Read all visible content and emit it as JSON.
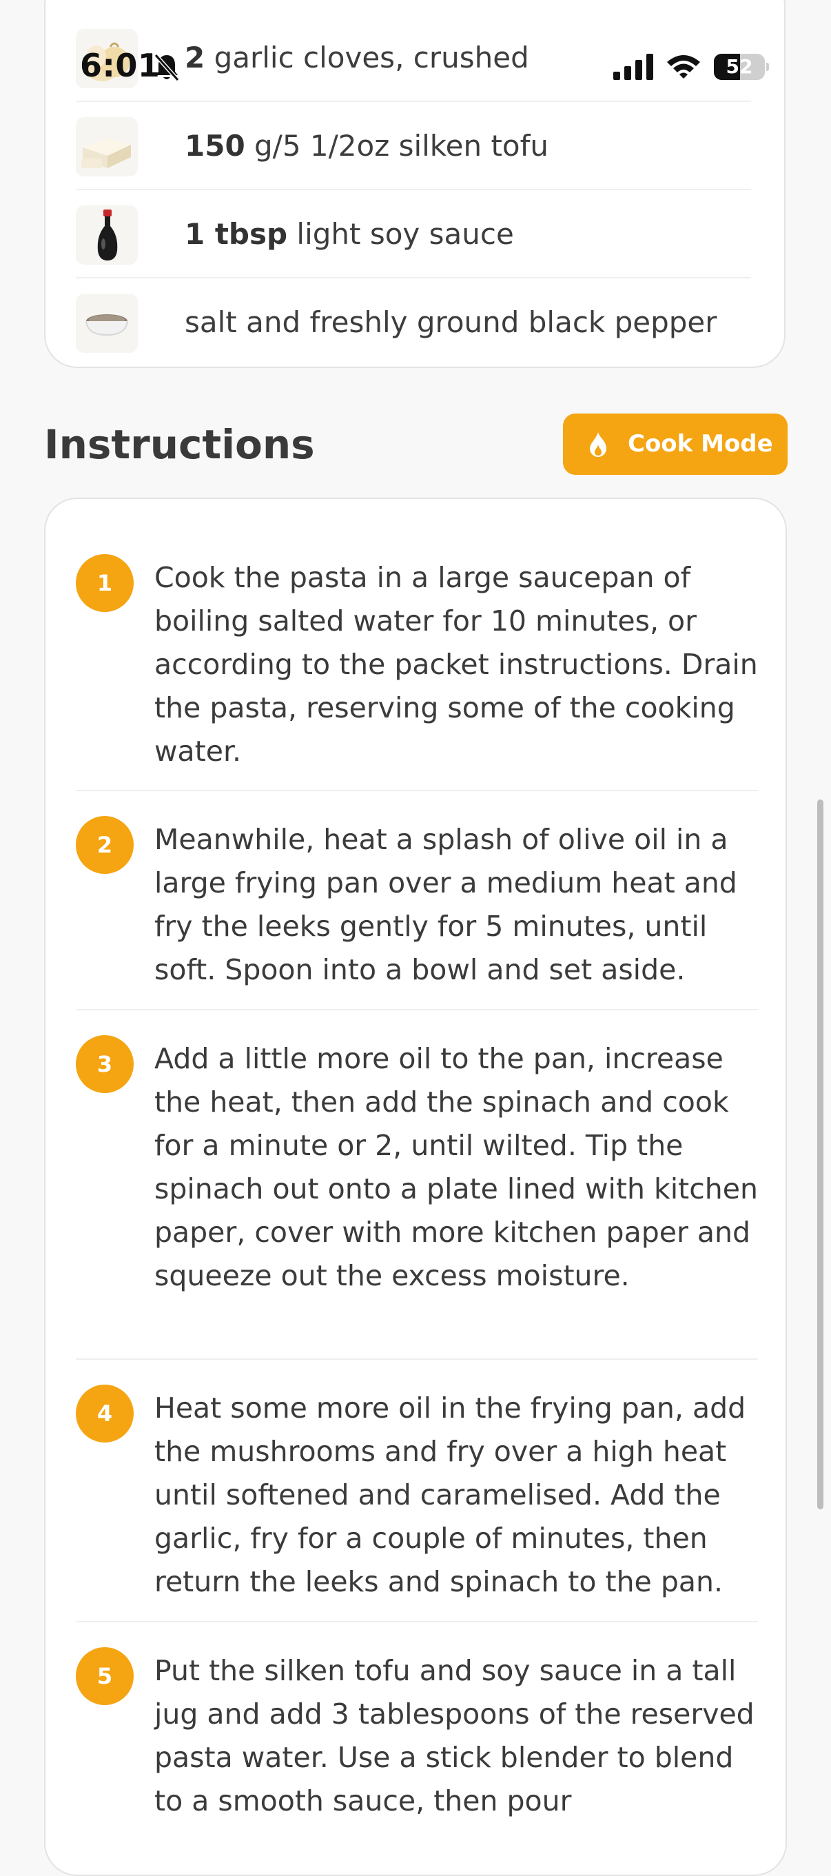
{
  "status_bar": {
    "time": "6:01",
    "battery_level": "52",
    "battery_fraction": 0.52,
    "icons": [
      "bell-slash-icon",
      "signal-icon",
      "wifi-icon",
      "battery-icon"
    ]
  },
  "ingredients": [
    {
      "amount": "2",
      "text": " garlic cloves, crushed",
      "icon": "garlic-icon"
    },
    {
      "amount": "150",
      "text": " g/5 1/2oz silken tofu",
      "icon": "tofu-icon"
    },
    {
      "amount": "1 tbsp",
      "text": " light soy sauce",
      "icon": "soy-sauce-icon"
    },
    {
      "amount": "",
      "text": "salt and freshly ground black pepper",
      "icon": "pepper-bowl-icon"
    }
  ],
  "instructions": {
    "title": "Instructions",
    "cook_mode_label": "Cook Mode",
    "steps": [
      {
        "number": "1",
        "text": "Cook the pasta in a large saucepan of boiling salted water for 10 minutes, or according to the packet instructions. Drain the pasta, reserving some of the cooking water."
      },
      {
        "number": "2",
        "text": "Meanwhile, heat a splash of olive oil in a large frying pan over a medium heat and fry the leeks gently for 5 minutes, until soft. Spoon into a bowl and set aside."
      },
      {
        "number": "3",
        "text": "Add a little more oil to the pan, increase the heat, then add the spinach and cook for a minute or 2, until wilted. Tip the spinach out onto a plate lined with kitchen paper, cover with more kitchen paper and squeeze out the excess moisture."
      },
      {
        "number": "4",
        "text": "Heat some more oil in the frying pan, add the mushrooms and fry over a high heat until softened and caramelised. Add the garlic, fry for a couple of minutes, then return the leeks and spinach to the pan."
      },
      {
        "number": "5",
        "text": "Put the silken tofu and soy sauce in a tall jug and add 3 tablespoons of the reserved pasta water. Use a stick blender to blend to a smooth sauce, then pour"
      }
    ]
  },
  "colors": {
    "accent": "#f5a412",
    "background": "#f8f8f8",
    "card": "#ffffff",
    "text": "#3a3a3a"
  }
}
